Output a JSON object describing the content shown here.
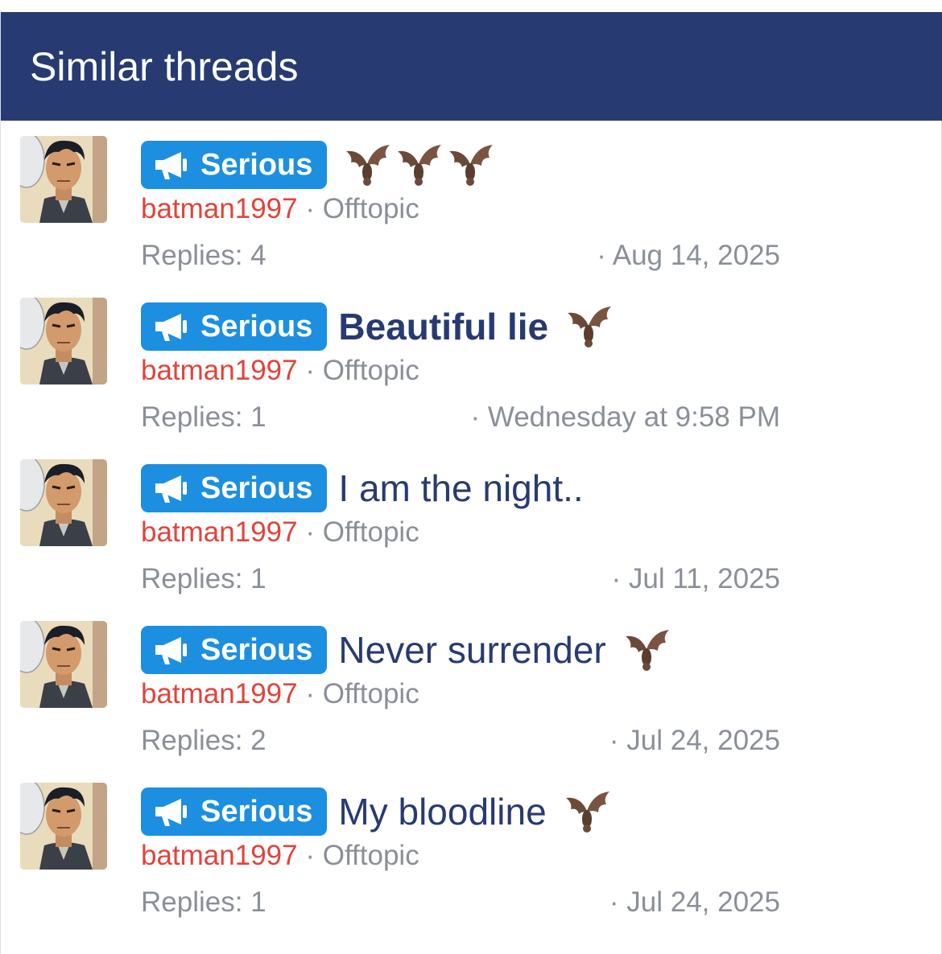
{
  "header": {
    "title": "Similar threads"
  },
  "threads": [
    {
      "prefix": "Serious",
      "title": "",
      "title_bold": false,
      "bats": 3,
      "author": "batman1997",
      "forum": "Offtopic",
      "replies": "Replies: 4",
      "date": "· Aug 14, 2025"
    },
    {
      "prefix": "Serious",
      "title": "Beautiful lie",
      "title_bold": true,
      "bats": 1,
      "author": "batman1997",
      "forum": "Offtopic",
      "replies": "Replies: 1",
      "date": "· Wednesday at 9:58 PM"
    },
    {
      "prefix": "Serious",
      "title": "I am the night..",
      "title_bold": false,
      "bats": 0,
      "author": "batman1997",
      "forum": "Offtopic",
      "replies": "Replies: 1",
      "date": "· Jul 11, 2025"
    },
    {
      "prefix": "Serious",
      "title": "Never surrender",
      "title_bold": false,
      "bats": 1,
      "author": "batman1997",
      "forum": "Offtopic",
      "replies": "Replies: 2",
      "date": "· Jul 24, 2025"
    },
    {
      "prefix": "Serious",
      "title": "My bloodline",
      "title_bold": false,
      "bats": 1,
      "author": "batman1997",
      "forum": "Offtopic",
      "replies": "Replies: 1",
      "date": "· Jul 24, 2025"
    }
  ],
  "separator": "·",
  "icons": {
    "prefix_icon": "megaphone-icon",
    "emoji": "bat-emoji-icon"
  },
  "colors": {
    "header_bg": "#273b72",
    "prefix_bg": "#1d8fe0",
    "author": "#e2433a",
    "title": "#273b72",
    "muted": "#8a8f99"
  }
}
